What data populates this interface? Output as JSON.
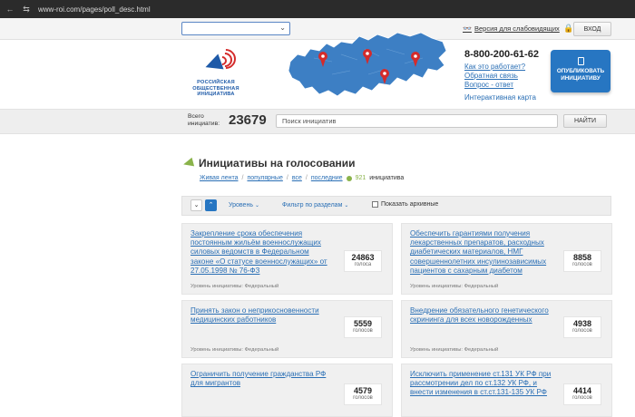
{
  "browser": {
    "url": "www-roi.com/pages/poll_desc.html",
    "nav_icon": "page-settings-icon"
  },
  "topbar": {
    "region_select_value": "",
    "vision_label": "Версия для слабовидящих",
    "login_label": "ВХОД"
  },
  "logo": {
    "line1": "РОССИЙСКАЯ",
    "line2": "ОБЩЕСТВЕННАЯ",
    "line3": "ИНИЦИАТИВА"
  },
  "header": {
    "phone": "8-800-200-61-62",
    "links": [
      "Как это работает?",
      "Обратная связь",
      "Вопрос - ответ"
    ],
    "map_link": "Интерактивная карта",
    "publish_line1": "ОПУБЛИКОВАТЬ",
    "publish_line2": "ИНИЦИАТИВУ"
  },
  "colors": {
    "accent": "#2776c2",
    "link": "#2a6fb5",
    "green": "#8ab34a",
    "map": "#3d7fc4",
    "pin": "#d42b2b"
  },
  "search": {
    "total_label_1": "Всего",
    "total_label_2": "инициатив:",
    "total_count": "23679",
    "placeholder": "Поиск инициатив",
    "button": "НАЙТИ"
  },
  "section": {
    "title": "Инициативы на голосовании",
    "filters": [
      "Живая лента",
      "популярные",
      "все",
      "последние"
    ],
    "count": "921",
    "count_label": "инициатива"
  },
  "toolbar": {
    "sort_down": "⌄",
    "sort_up": "⌃",
    "level_label": "Уровень",
    "section_filter_label": "Фильтр по разделам",
    "archive_label": "Показать архивные"
  },
  "cards": [
    {
      "title": "Закрепление срока обеспечения постоянным жильём военнослужащих силовых ведомств в Федеральном законе «О статусе военнослужащих» от 27.05.1998 № 76-ФЗ",
      "votes": "24863",
      "votes_label": "голоса",
      "level": "Уровень инициативы: Федеральный"
    },
    {
      "title": "Обеспечить гарантиями получения лекарственных препаратов, расходных диабетических материалов, НМГ совершеннолетних инсулинозависимых пациентов с сахарным диабетом",
      "votes": "8858",
      "votes_label": "голосов",
      "level": "Уровень инициативы: Федеральный"
    },
    {
      "title": "Принять закон о неприкосновенности медицинских работников",
      "votes": "5559",
      "votes_label": "голосов",
      "level": "Уровень инициативы: Федеральный"
    },
    {
      "title": "Внедрение обязательного генетического скрининга для всех новорожденных",
      "votes": "4938",
      "votes_label": "голосов",
      "level": "Уровень инициативы: Федеральный"
    },
    {
      "title": "Ограничить получение гражданства РФ для мигрантов",
      "votes": "4579",
      "votes_label": "голосов",
      "level": ""
    },
    {
      "title": "Исключить применение ст.131 УК РФ при рассмотрении дел по ст.132 УК РФ, и внести изменения в ст.ст.131-135 УК РФ",
      "votes": "4414",
      "votes_label": "голосов",
      "level": ""
    }
  ]
}
